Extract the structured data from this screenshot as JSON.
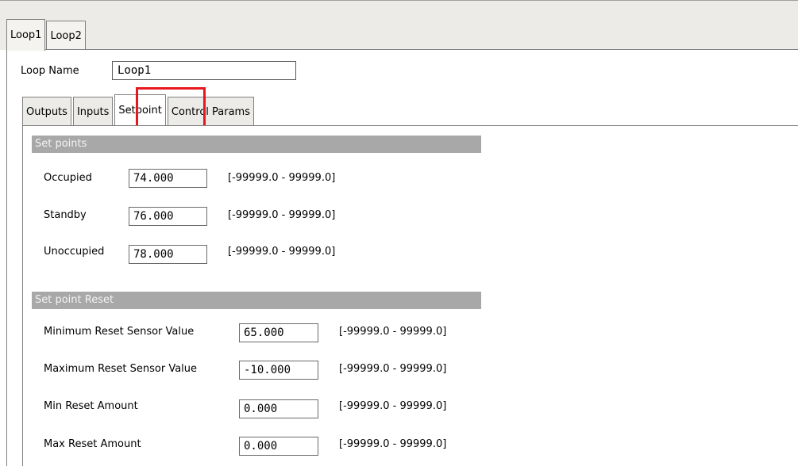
{
  "outer_tabs": [
    {
      "label": "Loop1",
      "active": true
    },
    {
      "label": "Loop2",
      "active": false
    }
  ],
  "loop_name": {
    "label": "Loop Name",
    "value": "Loop1"
  },
  "inner_tabs": [
    {
      "label": "Outputs",
      "active": false
    },
    {
      "label": "Inputs",
      "active": false
    },
    {
      "label": "Setpoint",
      "active": true
    },
    {
      "label": "Control Params",
      "active": false
    }
  ],
  "setpoints": {
    "header": "Set points",
    "fields": [
      {
        "label": "Occupied",
        "value": "74.000",
        "range": "[-99999.0 - 99999.0]"
      },
      {
        "label": "Standby",
        "value": "76.000",
        "range": "[-99999.0 - 99999.0]"
      },
      {
        "label": "Unoccupied",
        "value": "78.000",
        "range": "[-99999.0 - 99999.0]"
      }
    ]
  },
  "setpoint_reset": {
    "header": "Set point Reset",
    "fields": [
      {
        "label": "Minimum Reset Sensor Value",
        "value": "65.000",
        "range": "[-99999.0 - 99999.0]"
      },
      {
        "label": "Maximum Reset Sensor Value",
        "value": "-10.000",
        "range": "[-99999.0 - 99999.0]"
      },
      {
        "label": "Min Reset Amount",
        "value": "0.000",
        "range": "[-99999.0 - 99999.0]"
      },
      {
        "label": "Max Reset Amount",
        "value": "0.000",
        "range": "[-99999.0 - 99999.0]"
      }
    ]
  },
  "colors": {
    "highlight": "#e8161f",
    "section_header_bg": "#a8a8a8",
    "window_bg": "#ecebe7"
  }
}
